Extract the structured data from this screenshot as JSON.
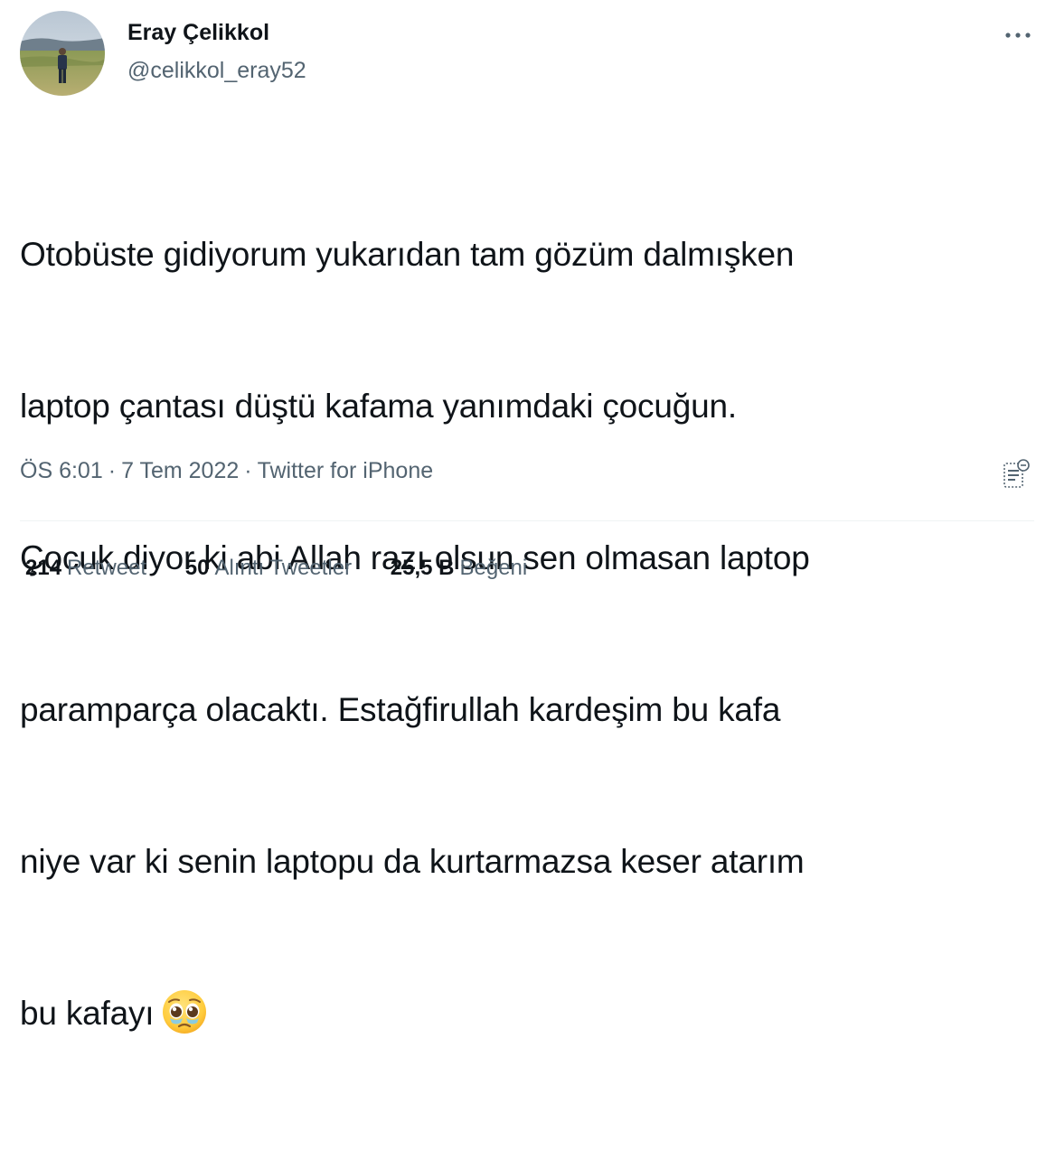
{
  "user": {
    "display_name": "Eray Çelikkol",
    "handle": "@celikkol_eray52"
  },
  "tweet": {
    "lines": [
      "Otobüste gidiyorum yukarıdan tam gözüm dalmışken",
      "laptop çantası düştü kafama yanımdaki çocuğun.",
      "Çocuk diyor ki abi Allah razı olsun sen olmasan laptop",
      "paramparça olacaktı. Estağfirullah kardeşim bu kafa",
      "niye var ki senin laptopu da kurtarmazsa keser atarım",
      "bu kafayı"
    ],
    "emoji": "pleading-face"
  },
  "meta": {
    "time": "ÖS 6:01",
    "separator": "·",
    "date": "7 Tem 2022",
    "source": "Twitter for iPhone"
  },
  "stats": {
    "retweets": {
      "count": "214",
      "label": "Retweet"
    },
    "quotes": {
      "count": "50",
      "label": "Alıntı Tweetler"
    },
    "likes": {
      "count": "25,5 B",
      "label": "Beğeni"
    }
  },
  "icons": {
    "more": "more-horizontal-icon",
    "analytics": "analytics-icon"
  },
  "colors": {
    "text_primary": "#0f1419",
    "text_secondary": "#536471",
    "divider": "#eff3f4"
  }
}
